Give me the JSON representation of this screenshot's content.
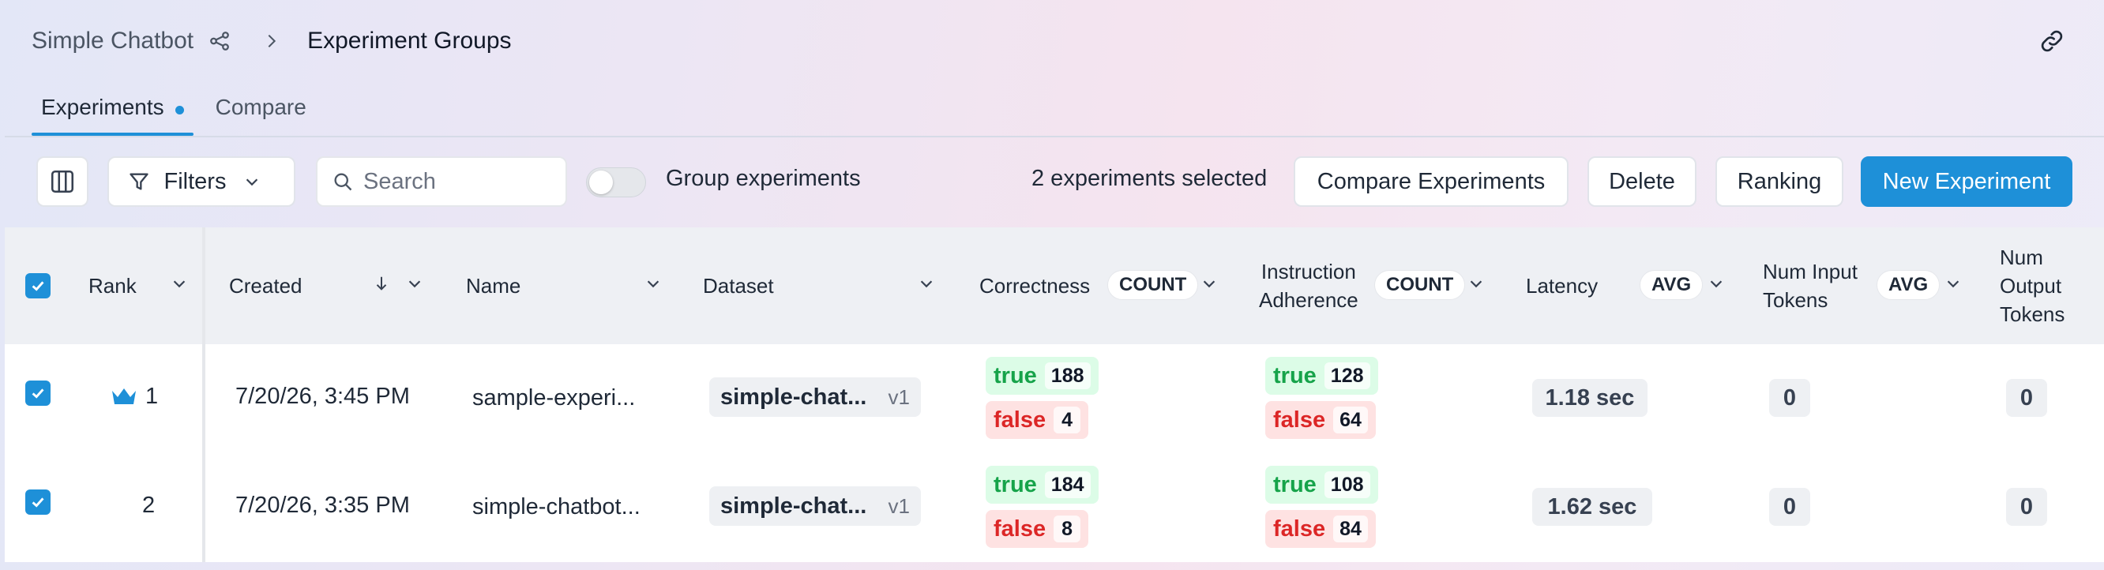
{
  "breadcrumb": {
    "app": "Simple Chatbot",
    "current": "Experiment Groups"
  },
  "tabs": [
    {
      "label": "Experiments",
      "active": true,
      "has_dot": true
    },
    {
      "label": "Compare",
      "active": false
    }
  ],
  "toolbar": {
    "filters_label": "Filters",
    "search_placeholder": "Search",
    "group_toggle_label": "Group experiments",
    "group_toggle_on": false,
    "selected_text": "2 experiments selected",
    "compare_label": "Compare Experiments",
    "delete_label": "Delete",
    "ranking_label": "Ranking",
    "new_label": "New Experiment"
  },
  "table": {
    "headers": {
      "rank": "Rank",
      "created": "Created",
      "name": "Name",
      "dataset": "Dataset",
      "correctness": "Correctness",
      "correctness_agg": "COUNT",
      "instruction_l1": "Instruction",
      "instruction_l2": "Adherence",
      "instruction_agg": "COUNT",
      "latency": "Latency",
      "latency_agg": "AVG",
      "input_l1": "Num Input",
      "input_l2": "Tokens",
      "input_agg": "AVG",
      "output_l1": "Num",
      "output_l2": "Output",
      "output_l3": "Tokens"
    },
    "rows": [
      {
        "selected": true,
        "rank": "1",
        "top_ranked": true,
        "created": "7/20/26, 3:45 PM",
        "name": "sample-experi...",
        "dataset": "simple-chat...",
        "dataset_version": "v1",
        "correctness": {
          "true_label": "true",
          "true_count": "188",
          "false_label": "false",
          "false_count": "4"
        },
        "instruction": {
          "true_label": "true",
          "true_count": "128",
          "false_label": "false",
          "false_count": "64"
        },
        "latency": "1.18 sec",
        "input_tokens": "0",
        "output_tokens": "0"
      },
      {
        "selected": true,
        "rank": "2",
        "top_ranked": false,
        "created": "7/20/26, 3:35 PM",
        "name": "simple-chatbot...",
        "dataset": "simple-chat...",
        "dataset_version": "v1",
        "correctness": {
          "true_label": "true",
          "true_count": "184",
          "false_label": "false",
          "false_count": "8"
        },
        "instruction": {
          "true_label": "true",
          "true_count": "108",
          "false_label": "false",
          "false_count": "84"
        },
        "latency": "1.62 sec",
        "input_tokens": "0",
        "output_tokens": "0"
      }
    ]
  },
  "colors": {
    "accent": "#1e90d8",
    "true_bg": "#dcfce7",
    "true_fg": "#16a34a",
    "false_bg": "#fee2e2",
    "false_fg": "#dc2626"
  },
  "icons": [
    "share-icon",
    "chevron-right-icon",
    "link-icon",
    "columns-icon",
    "filter-icon",
    "chevron-down-icon",
    "search-icon",
    "checkbox-checked-icon",
    "crown-icon",
    "sort-desc-icon"
  ]
}
